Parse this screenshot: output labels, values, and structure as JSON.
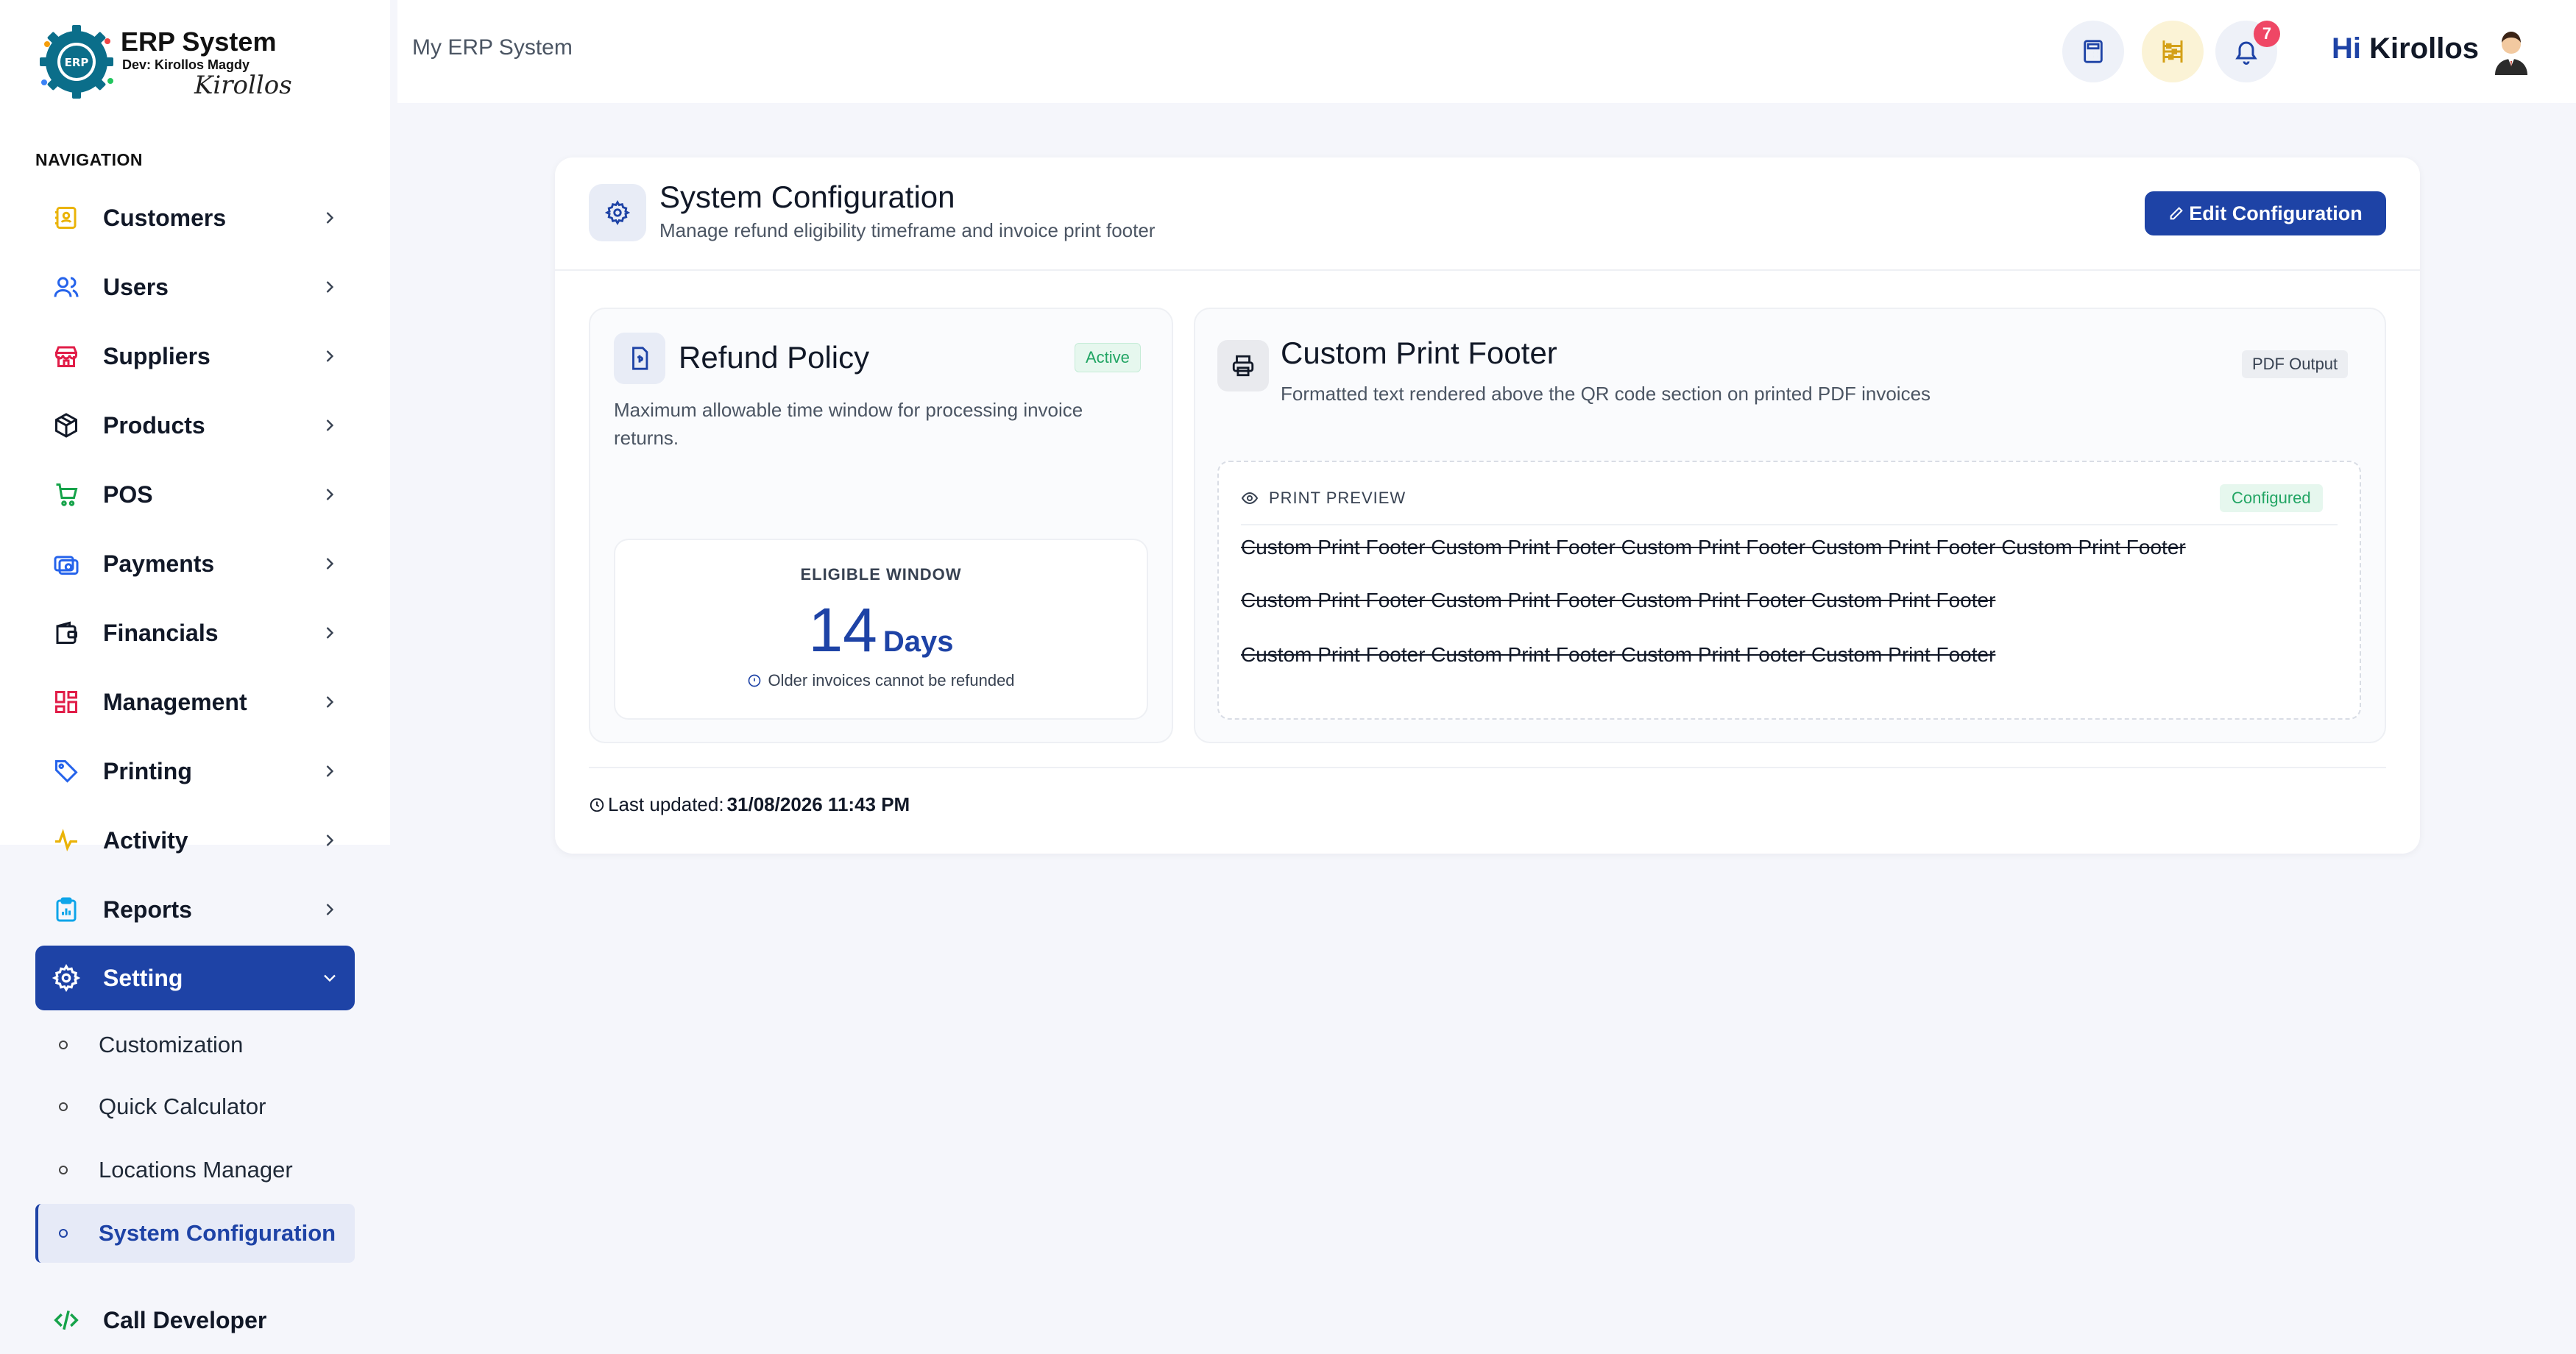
{
  "brand": {
    "title": "ERP System",
    "developer": "Dev: Kirollos Magdy",
    "signature": "Kirollos",
    "logo_text": "ERP"
  },
  "sidebar": {
    "heading": "NAVIGATION",
    "items": [
      {
        "label": "Customers",
        "icon": "customers-icon",
        "color": "#eab308"
      },
      {
        "label": "Users",
        "icon": "users-icon",
        "color": "#2563eb"
      },
      {
        "label": "Suppliers",
        "icon": "store-icon",
        "color": "#e11d48"
      },
      {
        "label": "Products",
        "icon": "box-icon",
        "color": "#111827"
      },
      {
        "label": "POS",
        "icon": "cart-icon",
        "color": "#16a34a"
      },
      {
        "label": "Payments",
        "icon": "payments-icon",
        "color": "#2563eb"
      },
      {
        "label": "Financials",
        "icon": "wallet-icon",
        "color": "#111827"
      },
      {
        "label": "Management",
        "icon": "grid-icon",
        "color": "#e11d48"
      },
      {
        "label": "Printing",
        "icon": "tag-icon",
        "color": "#2563eb"
      },
      {
        "label": "Activity",
        "icon": "activity-icon",
        "color": "#eab308"
      },
      {
        "label": "Reports",
        "icon": "reports-icon",
        "color": "#0ea5e9"
      },
      {
        "label": "Setting",
        "icon": "gear-icon",
        "color": "#ffffff"
      }
    ],
    "sub_items": [
      {
        "label": "Customization"
      },
      {
        "label": "Quick Calculator"
      },
      {
        "label": "Locations Manager"
      },
      {
        "label": "System Configuration"
      }
    ],
    "call_developer": "Call Developer"
  },
  "header": {
    "breadcrumb": "My ERP System",
    "notification_count": "7",
    "greeting_hi": "Hi",
    "greeting_name": "Kirollos"
  },
  "config": {
    "title": "System Configuration",
    "subtitle": "Manage refund eligibility timeframe and invoice print footer",
    "edit_label": "Edit Configuration",
    "refund": {
      "title": "Refund Policy",
      "status": "Active",
      "description": "Maximum allowable time window for processing invoice returns.",
      "window_label": "ELIGIBLE WINDOW",
      "days": "14",
      "unit": "Days",
      "note": "Older invoices cannot be refunded"
    },
    "footer": {
      "title": "Custom Print Footer",
      "description": "Formatted text rendered above the QR code section on printed PDF invoices",
      "output_tag": "PDF Output",
      "preview_label": "PRINT PREVIEW",
      "preview_status": "Configured",
      "lines": [
        "Custom Print Footer Custom Print Footer Custom Print Footer Custom Print Footer Custom Print Footer",
        "Custom Print Footer Custom Print Footer Custom Print Footer Custom Print Footer",
        "Custom Print Footer Custom Print Footer Custom Print Footer Custom Print Footer"
      ]
    },
    "last_updated_label": "Last updated:",
    "last_updated_value": "31/08/2026 11:43 PM"
  },
  "colors": {
    "primary": "#1e43a6",
    "success": "#22a564",
    "danger": "#ef4765"
  }
}
